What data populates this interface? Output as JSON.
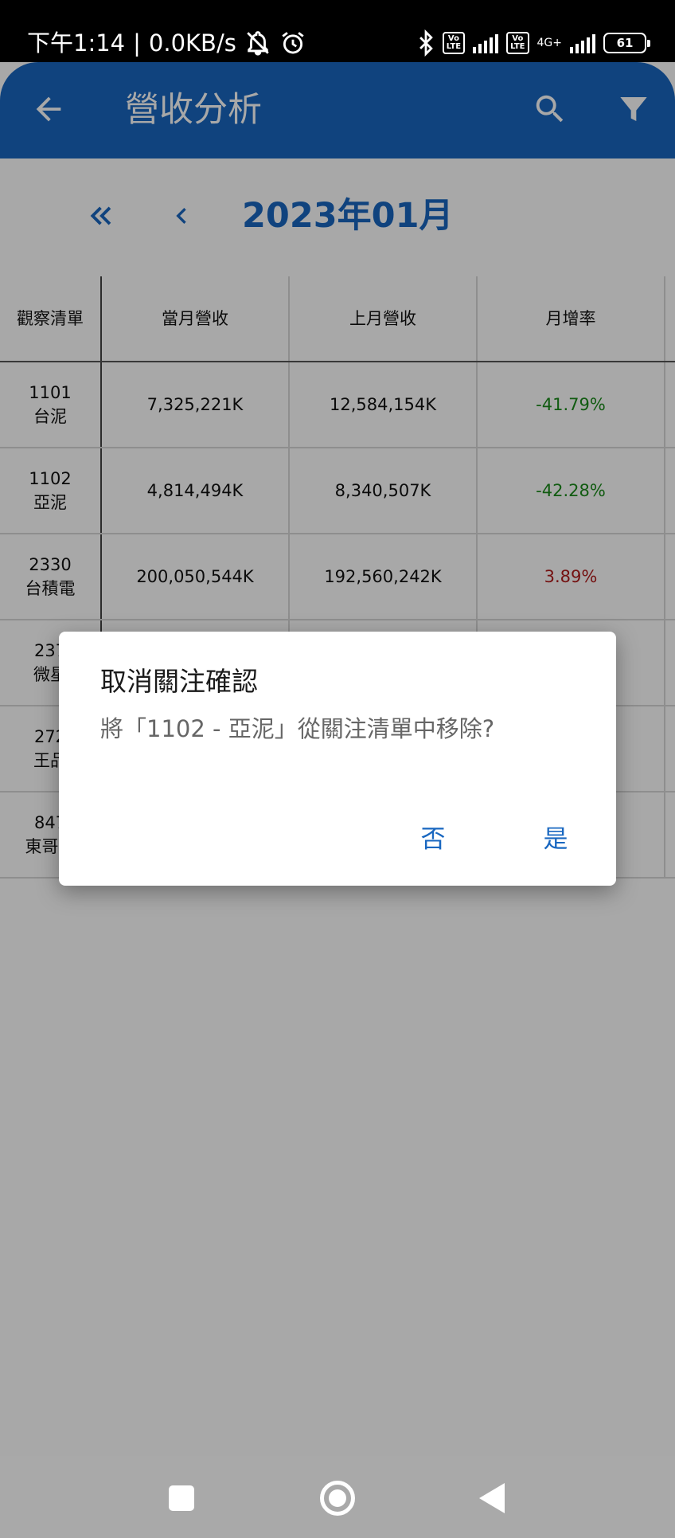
{
  "status_bar": {
    "time": "下午1:14",
    "speed": "0.0KB/s",
    "separator": "|",
    "volte1": "Vo\nLTE",
    "volte2": "Vo\nLTE",
    "network": "4G+",
    "battery": "61"
  },
  "app_bar": {
    "title": "營收分析"
  },
  "month_nav": {
    "label": "2023年01月"
  },
  "table": {
    "headers": [
      "觀察清單",
      "當月營收",
      "上月營收",
      "月增率"
    ],
    "rows": [
      {
        "code": "1101",
        "name": "台泥",
        "current": "7,325,221K",
        "previous": "12,584,154K",
        "growth": "-41.79%",
        "trend": "down"
      },
      {
        "code": "1102",
        "name": "亞泥",
        "current": "4,814,494K",
        "previous": "8,340,507K",
        "growth": "-42.28%",
        "trend": "down"
      },
      {
        "code": "2330",
        "name": "台積電",
        "current": "200,050,544K",
        "previous": "192,560,242K",
        "growth": "3.89%",
        "trend": "up"
      },
      {
        "code": "237",
        "name": "微星"
      },
      {
        "code": "272",
        "name": "王品"
      },
      {
        "code": "847",
        "name": "東哥遊"
      }
    ]
  },
  "dialog": {
    "title": "取消關注確認",
    "message": "將「1102 - 亞泥」從關注清單中移除?",
    "no_label": "否",
    "yes_label": "是"
  },
  "colors": {
    "primary": "#1967c0",
    "negative_growth": "#1a8a1a",
    "positive_growth": "#b01a1a"
  }
}
